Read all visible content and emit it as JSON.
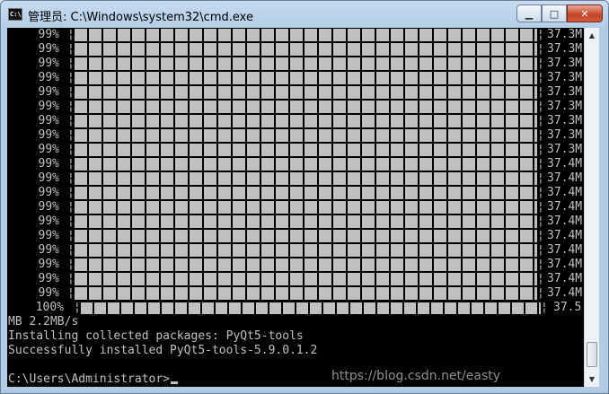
{
  "window": {
    "title": "管理员: C:\\Windows\\system32\\cmd.exe",
    "icon_text": "C:\\",
    "controls": {
      "minimize": "▁",
      "maximize": "□",
      "close": "✕"
    }
  },
  "console": {
    "progress_rows": [
      {
        "percent": "99%",
        "size": "37.3M"
      },
      {
        "percent": "99%",
        "size": "37.3M"
      },
      {
        "percent": "99%",
        "size": "37.3M"
      },
      {
        "percent": "99%",
        "size": "37.3M"
      },
      {
        "percent": "99%",
        "size": "37.3M"
      },
      {
        "percent": "99%",
        "size": "37.3M"
      },
      {
        "percent": "99%",
        "size": "37.3M"
      },
      {
        "percent": "99%",
        "size": "37.3M"
      },
      {
        "percent": "99%",
        "size": "37.3M"
      },
      {
        "percent": "99%",
        "size": "37.4M"
      },
      {
        "percent": "99%",
        "size": "37.4M"
      },
      {
        "percent": "99%",
        "size": "37.4M"
      },
      {
        "percent": "99%",
        "size": "37.4M"
      },
      {
        "percent": "99%",
        "size": "37.4M"
      },
      {
        "percent": "99%",
        "size": "37.4M"
      },
      {
        "percent": "99%",
        "size": "37.4M"
      },
      {
        "percent": "99%",
        "size": "37.4M"
      },
      {
        "percent": "99%",
        "size": "37.4M"
      },
      {
        "percent": "99%",
        "size": "37.4M"
      }
    ],
    "final_row": {
      "percent": "100%",
      "size": "37.5"
    },
    "lines": [
      "MB 2.2MB/s",
      "Installing collected packages: PyQt5-tools",
      "Successfully installed PyQt5-tools-5.9.0.1.2",
      "",
      "C:\\Users\\Administrator>"
    ],
    "separator": "¦"
  },
  "scrollbar": {
    "up": "▲",
    "down": "▼"
  },
  "watermark": "https://blog.csdn.net/easty"
}
